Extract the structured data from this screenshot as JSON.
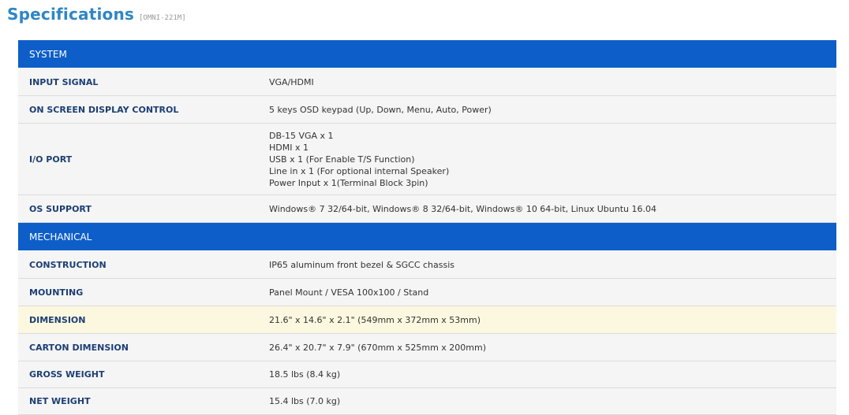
{
  "header": {
    "title": "Specifications",
    "model": "[OMNI-221M]"
  },
  "sections": [
    {
      "name": "SYSTEM",
      "rows": [
        {
          "label": "INPUT SIGNAL",
          "value": "VGA/HDMI"
        },
        {
          "label": "ON SCREEN DISPLAY CONTROL",
          "value": "5 keys OSD keypad (Up, Down, Menu, Auto, Power)"
        },
        {
          "label": "I/O PORT",
          "lines": [
            "DB-15 VGA x 1",
            "HDMI x 1",
            "USB x 1 (For Enable T/S Function)",
            "Line in x 1 (For optional internal Speaker)",
            "Power Input x 1(Terminal Block 3pin)"
          ]
        },
        {
          "label": "OS SUPPORT",
          "value": "Windows® 7 32/64-bit, Windows® 8 32/64-bit, Windows® 10 64-bit, Linux Ubuntu 16.04"
        }
      ]
    },
    {
      "name": "MECHANICAL",
      "rows": [
        {
          "label": "CONSTRUCTION",
          "value": "IP65 aluminum front bezel & SGCC chassis"
        },
        {
          "label": "MOUNTING",
          "value": "Panel Mount / VESA 100x100 / Stand"
        },
        {
          "label": "DIMENSION",
          "value": "21.6\" x 14.6\" x 2.1\" (549mm x 372mm x 53mm)"
        },
        {
          "label": "CARTON DIMENSION",
          "value": "26.4\" x 20.7\" x 7.9\" (670mm x 525mm x 200mm)"
        },
        {
          "label": "GROSS WEIGHT",
          "value": "18.5 lbs (8.4 kg)"
        },
        {
          "label": "NET WEIGHT",
          "value": "15.4 lbs (7.0 kg)"
        }
      ]
    }
  ],
  "colors": {
    "title": "#2f86c4",
    "section_header": "#0d5ec8",
    "row_background": "#f5f5f5",
    "highlight_row": "#fcf8e0",
    "label_text": "#1c3e73"
  }
}
